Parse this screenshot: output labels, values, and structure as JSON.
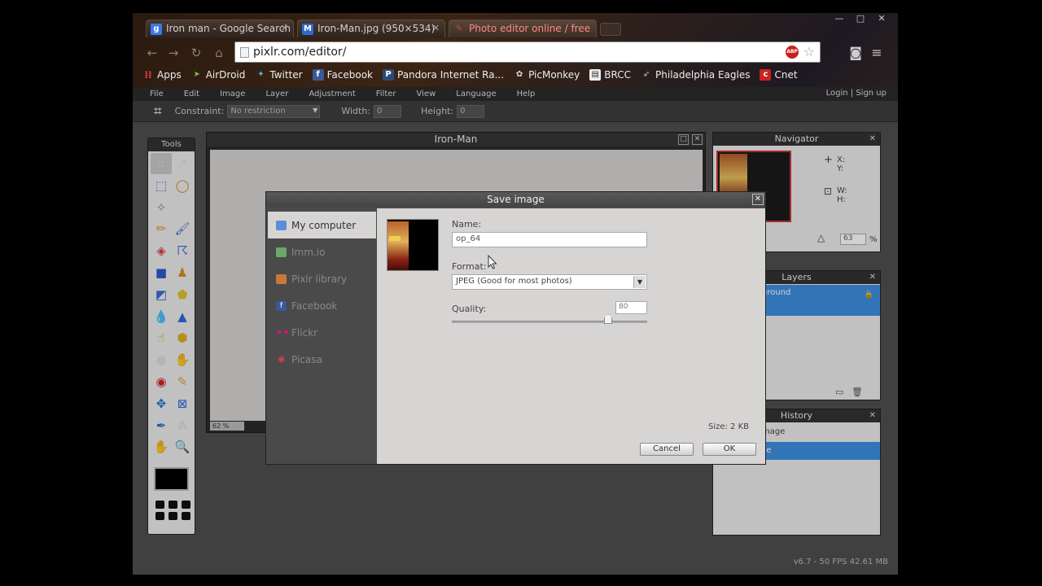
{
  "browser": {
    "window_controls": [
      "—",
      "□",
      "✕"
    ],
    "tabs": [
      {
        "favicon": "g",
        "label": "Iron man - Google Search",
        "active": false
      },
      {
        "favicon": "M",
        "label": "Iron-Man.jpg (950×534)",
        "active": false
      },
      {
        "favicon": "",
        "label": "Photo editor online / free",
        "active": true
      }
    ],
    "url": "pixlr.com/editor/",
    "bookmarks": [
      {
        "icon": "apps-icon",
        "label": "Apps"
      },
      {
        "icon": "airdroid-icon",
        "label": "AirDroid"
      },
      {
        "icon": "twitter-icon",
        "label": "Twitter"
      },
      {
        "icon": "facebook-icon",
        "label": "Facebook"
      },
      {
        "icon": "pandora-icon",
        "label": "Pandora Internet Ra..."
      },
      {
        "icon": "picmonkey-icon",
        "label": "PicMonkey"
      },
      {
        "icon": "brcc-icon",
        "label": "BRCC"
      },
      {
        "icon": "eagles-icon",
        "label": "Philadelphia Eagles"
      },
      {
        "icon": "cnet-icon",
        "label": "Cnet"
      }
    ]
  },
  "pixlr": {
    "menu": [
      "File",
      "Edit",
      "Image",
      "Layer",
      "Adjustment",
      "Filter",
      "View",
      "Language",
      "Help"
    ],
    "login": "Login | Sign up",
    "options": {
      "constraint_label": "Constraint:",
      "constraint_value": "No restriction",
      "width_label": "Width:",
      "width_value": "0",
      "height_label": "Height:",
      "height_value": "0"
    },
    "tools_title": "Tools",
    "document_title": "Iron-Man",
    "zoom_value": "62",
    "zoom_unit": "%",
    "navigator": {
      "title": "Navigator",
      "x_label": "X:",
      "y_label": "Y:",
      "w_label": "W:",
      "h_label": "H:",
      "zoom": "63",
      "zoom_unit": "%"
    },
    "layers": {
      "title": "Layers",
      "item": "ground"
    },
    "history": {
      "title": "History",
      "item1": "mage",
      "item2": "ze"
    },
    "fps": "v6.7 - 50 FPS 42.61 MB"
  },
  "save_dialog": {
    "title": "Save image",
    "destinations": [
      {
        "icon": "computer-icon",
        "label": "My computer",
        "active": true,
        "color": "#5a8fd8"
      },
      {
        "icon": "immio-icon",
        "label": "Imm.io",
        "active": false,
        "color": "#6aa86a"
      },
      {
        "icon": "library-icon",
        "label": "Pixlr library",
        "active": false,
        "color": "#c8783a"
      },
      {
        "icon": "facebook-icon",
        "label": "Facebook",
        "active": false,
        "color": "#3b5998"
      },
      {
        "icon": "flickr-icon",
        "label": "Flickr",
        "active": false,
        "color": "#ff0084"
      },
      {
        "icon": "picasa-icon",
        "label": "Picasa",
        "active": false,
        "color": "#d04040"
      }
    ],
    "name_label": "Name:",
    "name_value": "op_64",
    "format_label": "Format:",
    "format_value": "JPEG (Good for most photos)",
    "quality_label": "Quality:",
    "quality_value": "80",
    "quality": 80,
    "size_label": "Size: 2 KB",
    "cancel_label": "Cancel",
    "ok_label": "OK"
  }
}
